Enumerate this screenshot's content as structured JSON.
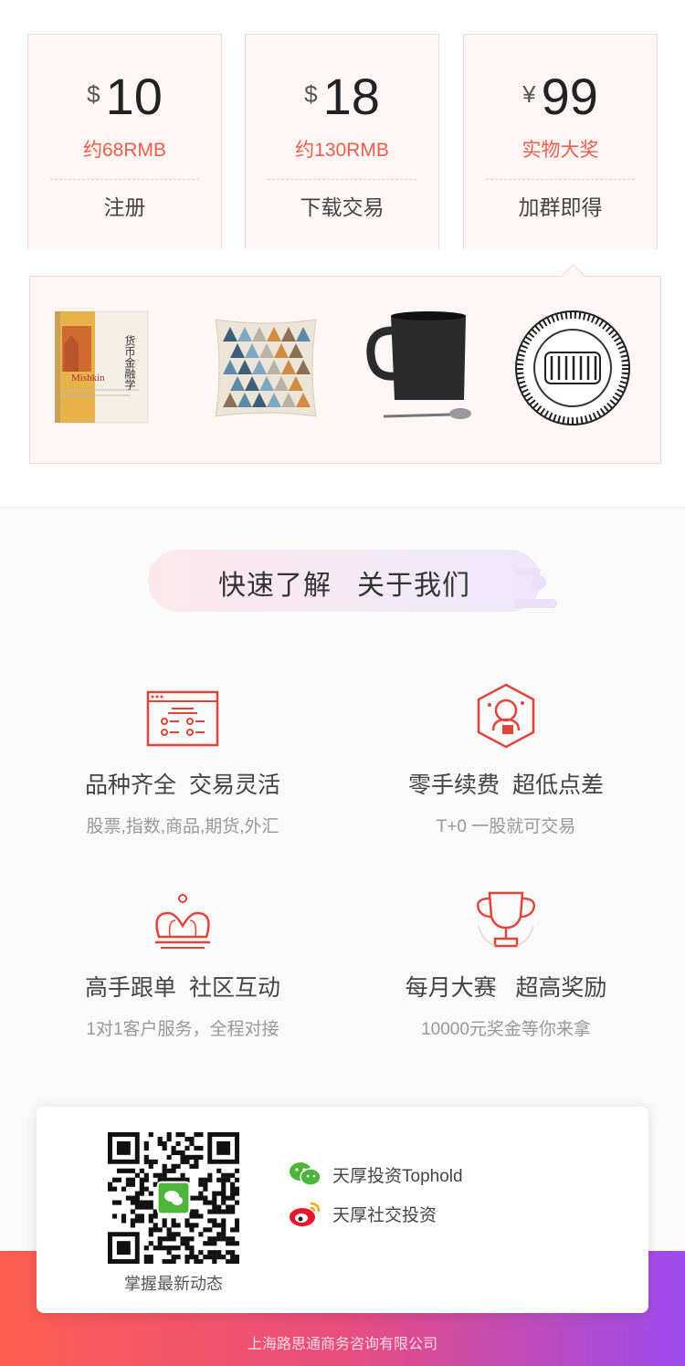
{
  "cards": [
    {
      "currency": "$",
      "amount": "10",
      "sub": "约68RMB",
      "action": "注册"
    },
    {
      "currency": "$",
      "amount": "18",
      "sub": "约130RMB",
      "action": "下载交易"
    },
    {
      "currency": "¥",
      "amount": "99",
      "sub": "实物大奖",
      "action": "加群即得"
    }
  ],
  "prizes": {
    "book_title": "货币金融学",
    "book_author": "Mishkin"
  },
  "section_title": "快速了解   关于我们",
  "features": [
    {
      "title": "品种齐全  交易灵活",
      "sub": "股票,指数,商品,期货,外汇",
      "icon": "browser-list-icon"
    },
    {
      "title": "零手续费  超低点差",
      "sub": "T+0 一股就可交易",
      "icon": "hexagon-astronaut-icon"
    },
    {
      "title": "高手跟单  社区互动",
      "sub": "1对1客户服务，全程对接",
      "icon": "crown-icon"
    },
    {
      "title": "每月大赛   超高奖励",
      "sub": "10000元奖金等你来拿",
      "icon": "trophy-icon"
    }
  ],
  "follow": {
    "qr_caption": "掌握最新动态",
    "wechat": "天厚投资Tophold",
    "weibo": "天厚社交投资"
  },
  "company": "上海路思通商务咨询有限公司",
  "colors": {
    "accent": "#ee5c4c",
    "icon_red": "#e2443a",
    "grad_start": "#fb5e4f",
    "grad_end": "#9d4cef"
  }
}
